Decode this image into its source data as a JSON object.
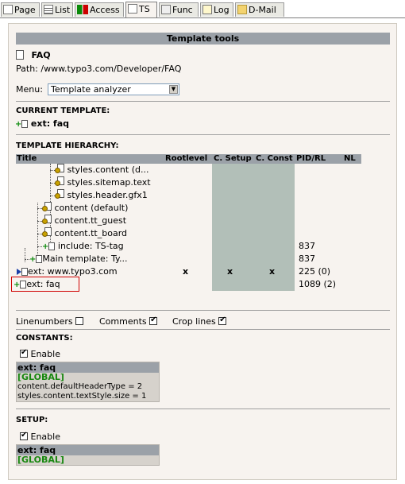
{
  "tabs": [
    {
      "label": "Page",
      "icon": "page-icon"
    },
    {
      "label": "List",
      "icon": "list-icon"
    },
    {
      "label": "Access",
      "icon": "access-icon"
    },
    {
      "label": "TS",
      "icon": "ts-icon"
    },
    {
      "label": "Func",
      "icon": "func-icon"
    },
    {
      "label": "Log",
      "icon": "log-icon"
    },
    {
      "label": "D-Mail",
      "icon": "mail-icon"
    }
  ],
  "header": {
    "title": "Template tools"
  },
  "page": {
    "name": "FAQ",
    "path": "Path: /www.typo3.com/Developer/FAQ"
  },
  "menu": {
    "label": "Menu:",
    "selected": "Template analyzer"
  },
  "current_template": {
    "heading": "CURRENT TEMPLATE:",
    "name": "ext: faq"
  },
  "hierarchy": {
    "heading": "TEMPLATE HIERARCHY:",
    "columns": {
      "title": "Title",
      "rootlevel": "Rootlevel",
      "csetup": "C. Setup",
      "cconst": "C. Const",
      "pid": "PID/RL",
      "nl": "NL"
    },
    "rows": [
      {
        "title": "styles.content (d...",
        "rootlevel": "",
        "csetup": "",
        "cconst": "",
        "pid": ""
      },
      {
        "title": "styles.sitemap.text",
        "rootlevel": "",
        "csetup": "",
        "cconst": "",
        "pid": ""
      },
      {
        "title": "styles.header.gfx1",
        "rootlevel": "",
        "csetup": "",
        "cconst": "",
        "pid": ""
      },
      {
        "title": "content (default)",
        "rootlevel": "",
        "csetup": "",
        "cconst": "",
        "pid": ""
      },
      {
        "title": "content.tt_guest",
        "rootlevel": "",
        "csetup": "",
        "cconst": "",
        "pid": ""
      },
      {
        "title": "content.tt_board",
        "rootlevel": "",
        "csetup": "",
        "cconst": "",
        "pid": ""
      },
      {
        "title": "include: TS-tag",
        "rootlevel": "",
        "csetup": "",
        "cconst": "",
        "pid": "837"
      },
      {
        "title": "Main template: Ty...",
        "rootlevel": "",
        "csetup": "",
        "cconst": "",
        "pid": "837"
      },
      {
        "title": "ext: www.typo3.com",
        "rootlevel": "x",
        "csetup": "x",
        "cconst": "x",
        "pid": "225 (0)"
      },
      {
        "title": "ext: faq",
        "rootlevel": "",
        "csetup": "",
        "cconst": "",
        "pid": "1089 (2)"
      }
    ]
  },
  "options": {
    "linenumbers": "Linenumbers",
    "comments": "Comments",
    "crop": "Crop lines"
  },
  "constants": {
    "heading": "CONSTANTS:",
    "enable": "Enable",
    "box_title": "ext: faq",
    "global": "[GLOBAL]",
    "lines": [
      "content.defaultHeaderType = 2",
      "styles.content.textStyle.size = 1"
    ]
  },
  "setup": {
    "heading": "SETUP:",
    "enable": "Enable",
    "box_title": "ext: faq",
    "global": "[GLOBAL]"
  },
  "colors": {
    "accent_red": "#D00000",
    "header_gray": "#9BA1A8",
    "global_green": "#17870F",
    "panel_bg": "#F7F3EF",
    "column_bg": "#B2BFB8"
  }
}
